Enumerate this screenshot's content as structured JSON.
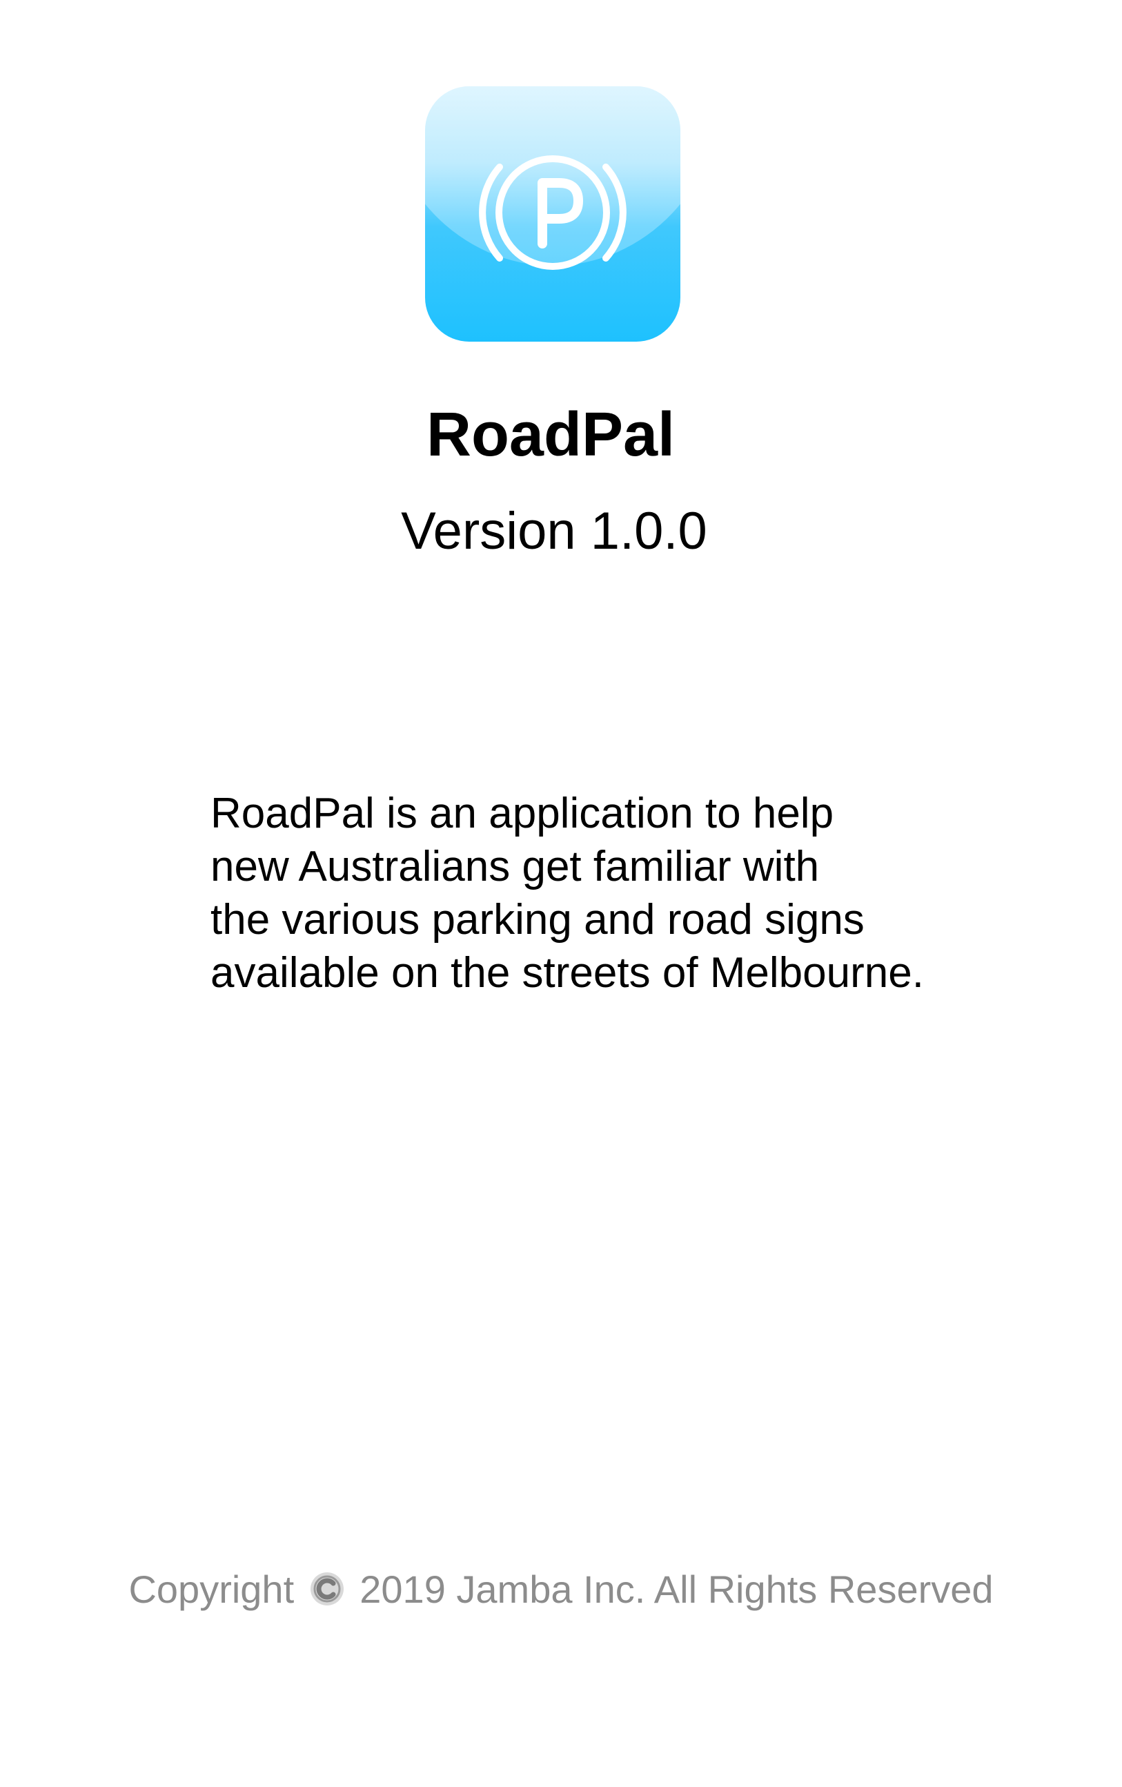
{
  "app": {
    "icon": "parking-brake-icon",
    "accent_color": "#1ec1fe",
    "name": "RoadPal",
    "version_label": "Version 1.0.0"
  },
  "description": {
    "lines": [
      "RoadPal is an application to help",
      "new Australians get familiar with",
      "the various parking and road signs",
      "available on the streets of Melbourne."
    ]
  },
  "footer": {
    "copyright_prefix": "Copyright",
    "copyright_icon": "copyright-icon",
    "copyright_suffix": "2019 Jamba Inc. All Rights Reserved",
    "text_color": "#8c8c8c"
  }
}
